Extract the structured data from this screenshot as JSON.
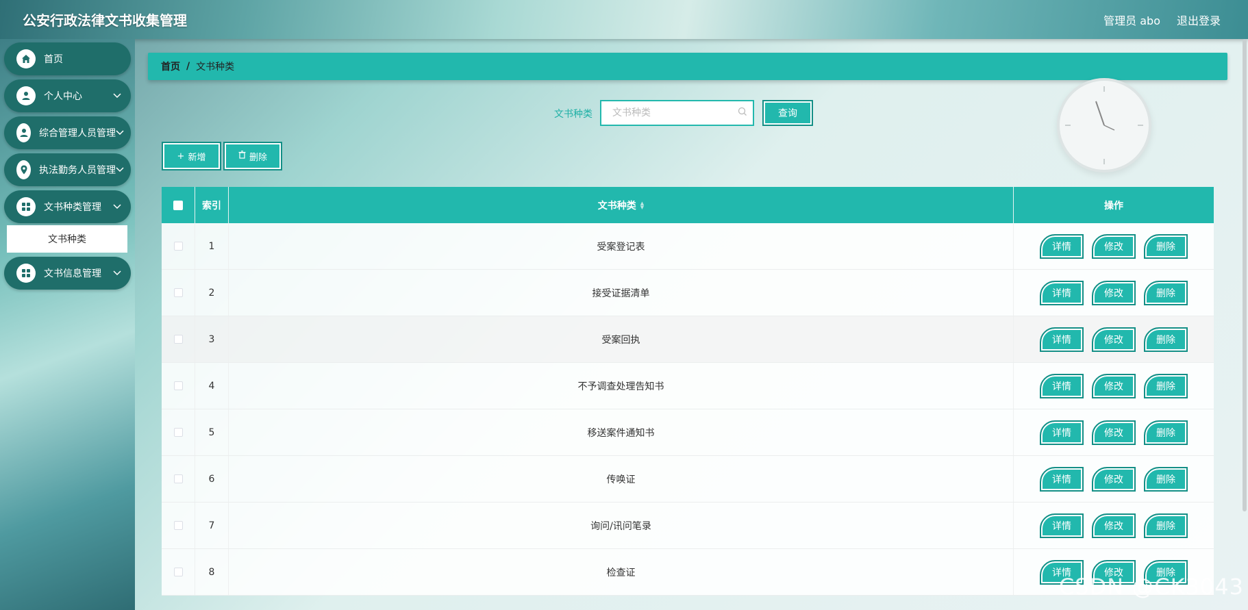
{
  "header": {
    "title": "公安行政法律文书收集管理",
    "user_label": "管理员 abo",
    "logout_label": "退出登录"
  },
  "sidebar": {
    "items": [
      {
        "label": "首页",
        "icon": "home-icon"
      },
      {
        "label": "个人中心",
        "icon": "person-icon"
      },
      {
        "label": "综合管理人员管理",
        "icon": "user-icon"
      },
      {
        "label": "执法勤务人员管理",
        "icon": "location-icon"
      },
      {
        "label": "文书种类管理",
        "icon": "grid-icon"
      },
      {
        "label": "文书信息管理",
        "icon": "grid-icon"
      }
    ],
    "submenu_active": "文书种类"
  },
  "breadcrumb": {
    "home": "首页",
    "separator": "/",
    "current": "文书种类"
  },
  "search": {
    "label": "文书种类",
    "placeholder": "文书种类",
    "value": "",
    "button": "查询"
  },
  "toolbar": {
    "add_label": "新增",
    "delete_label": "删除"
  },
  "table": {
    "headers": {
      "index": "索引",
      "name": "文书种类",
      "ops": "操作"
    },
    "rows": [
      {
        "index": "1",
        "name": "受案登记表"
      },
      {
        "index": "2",
        "name": "接受证据清单"
      },
      {
        "index": "3",
        "name": "受案回执"
      },
      {
        "index": "4",
        "name": "不予调查处理告知书"
      },
      {
        "index": "5",
        "name": "移送案件通知书"
      },
      {
        "index": "6",
        "name": "传唤证"
      },
      {
        "index": "7",
        "name": "询问/讯问笔录"
      },
      {
        "index": "8",
        "name": "检查证"
      }
    ],
    "row_actions": {
      "detail": "详情",
      "edit": "修改",
      "delete": "删除"
    }
  },
  "watermark": "CSDN @CK3043",
  "colors": {
    "accent": "#22b8ad",
    "accent_border": "#138f86",
    "menu_bg": "#1f6e6a"
  }
}
